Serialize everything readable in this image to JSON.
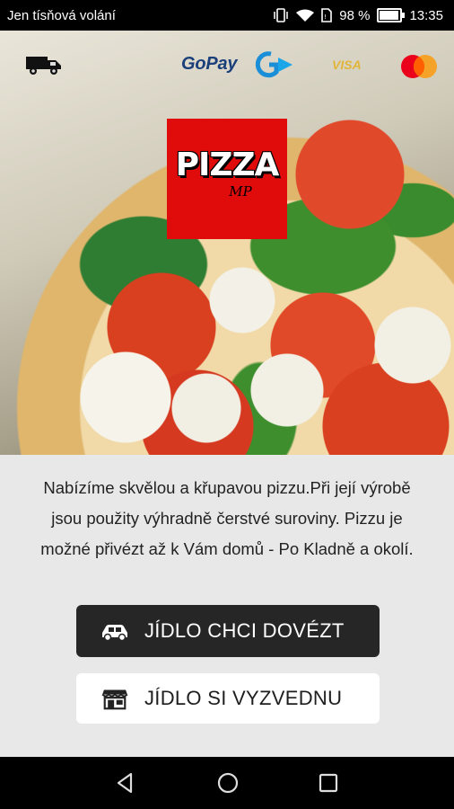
{
  "status_bar": {
    "carrier": "Jen tísňová volání",
    "battery_level": "98 %",
    "time": "13:35",
    "icons": [
      "vibrate-icon",
      "wifi-icon",
      "sim-icon",
      "battery-icon"
    ]
  },
  "header": {
    "payment_gopay": "GoPay",
    "payment_visa": "VISA",
    "payment_icons": [
      "delivery-truck-icon",
      "gopay-logo",
      "visa-logo",
      "mastercard-logo"
    ]
  },
  "logo": {
    "title": "PIZZA",
    "subtitle": "MP",
    "background": "#e00b0b"
  },
  "content": {
    "description": "Nabízíme skvělou a křupavou pizzu.Při její výrobě jsou použity výhradně čerstvé suroviny. Pizzu je možné přivézt až k Vám domů - Po Kladně a okolí.",
    "delivery_button": "JÍDLO CHCI DOVÉZT",
    "pickup_button": "JÍDLO SI VYZVEDNU",
    "delivery_icon": "car-icon",
    "pickup_icon": "store-icon"
  },
  "navigation": {
    "buttons": [
      "back-icon",
      "home-icon",
      "recents-icon"
    ]
  }
}
